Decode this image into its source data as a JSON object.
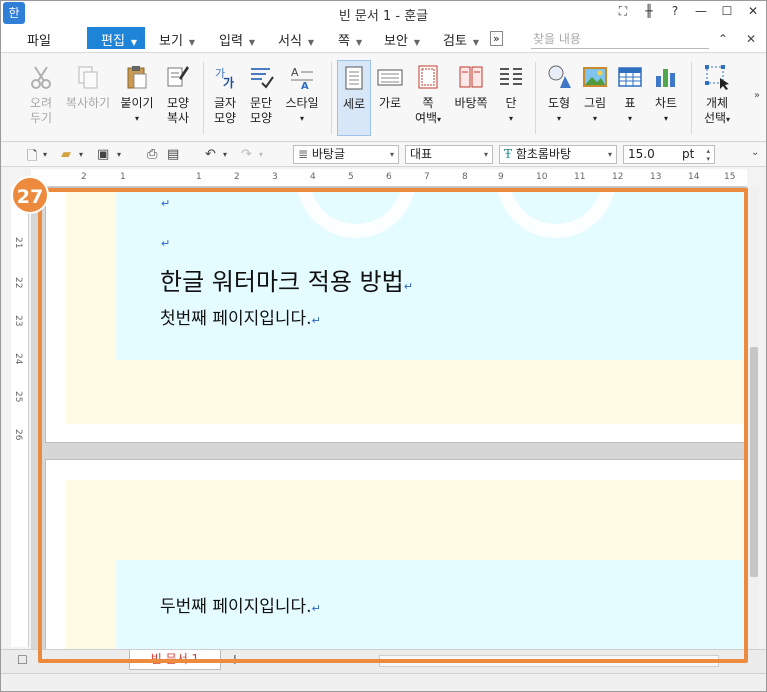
{
  "window": {
    "app_icon": "한",
    "title": "빈 문서 1 - 훈글",
    "controls": [
      "⛶",
      "╫",
      "?",
      "—",
      "☐",
      "✕"
    ]
  },
  "menu": {
    "file": "파일",
    "edit": "편집",
    "view": "보기",
    "insert": "입력",
    "format": "서식",
    "page": "쪽",
    "security": "보안",
    "review": "검토",
    "more": "»",
    "search_placeholder": "찾을 내용",
    "collapse": "⌃",
    "close": "✕"
  },
  "ribbon": {
    "cut": [
      "오려",
      "두기"
    ],
    "copy": "복사하기",
    "paste": "붙이기",
    "format_copy": [
      "모양",
      "복사"
    ],
    "char_shape": [
      "글자",
      "모양"
    ],
    "para_shape": [
      "문단",
      "모양"
    ],
    "style": "스타일",
    "portrait": "세로",
    "landscape": "가로",
    "margins": [
      "쪽",
      "여백"
    ],
    "background": "바탕쪽",
    "columns": "단",
    "shapes": "도형",
    "picture": "그림",
    "table": "표",
    "chart": "차트",
    "object_select": [
      "개체",
      "선택"
    ],
    "more": "»"
  },
  "format_toolbar": {
    "style_value": "바탕글",
    "lang_value": "대표",
    "font_value": "함초롬바탕",
    "size_value": "15.0",
    "size_unit": "pt"
  },
  "ruler": {
    "h_ticks": [
      "2",
      "1",
      "1",
      "2",
      "3",
      "4",
      "5",
      "6",
      "7",
      "8",
      "9",
      "10",
      "11",
      "12",
      "13",
      "14",
      "15"
    ],
    "v_ticks": [
      "21",
      "22",
      "23",
      "24",
      "25",
      "26"
    ]
  },
  "document": {
    "heading": "한글 워터마크 적용 방법",
    "page1_line": "첫번째 페이지입니다.",
    "page2_line": "두번째 페이지입니다.",
    "para_mark": "↵"
  },
  "tabs": {
    "doc_tab": "빈 문서 1",
    "add": "+"
  },
  "annotation": {
    "step": "27",
    "color": "#ec8a3e"
  }
}
